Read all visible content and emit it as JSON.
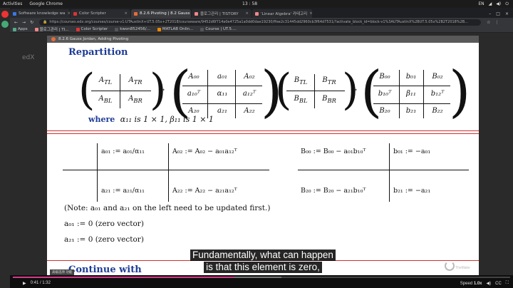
{
  "os_bar": {
    "activities": "Activities",
    "app": "Google Chrome",
    "clock": "13 : 58",
    "lang": "EN"
  },
  "tabs": [
    {
      "label": "Software knowledge wa",
      "color": "#3b78e7"
    },
    {
      "label": "Color Scripter",
      "color": "#d33"
    },
    {
      "label": "8.2.6 Pivoting | 8.2 Gauss",
      "color": "#e86a3a",
      "active": true
    },
    {
      "label": "블로그관리 | TISTORY",
      "color": "#e88"
    },
    {
      "label": "'Linear Algebra' 카테고리",
      "color": "#e88"
    }
  ],
  "address": {
    "url": "https://courses.edx.org/courses/course-v1:UTAustinX+UT.5.05x+2T2018/courseware/9452d6f714a0e4725a1a0dd0dae19230/ffee2c31445dd2960cb3f64d7531/?activate_block_id=block-v1%3AUTAustinX%2BUT.5.05x%2B2T2018%2B..."
  },
  "bookmarks": [
    {
      "label": "Apps",
      "color": "#5a8"
    },
    {
      "label": "블로그관리 | TI...",
      "color": "#e88"
    },
    {
      "label": "Color Scripter",
      "color": "#d33"
    },
    {
      "label": "kwon852456/...",
      "color": "#555"
    },
    {
      "label": "MATLAB Onlin...",
      "color": "#e80"
    },
    {
      "label": "Course | UT.5....",
      "color": "#555"
    }
  ],
  "page_bg_text": "edX",
  "video_title": "8.2.6 Gauss Jordan, Adding Pivoting",
  "slide": {
    "heading": "Repartition",
    "lhs_A": [
      [
        "A",
        "TL",
        "A",
        "TR"
      ],
      [
        "A",
        "BL",
        "A",
        "BR"
      ]
    ],
    "arrow": "→",
    "comma": ",",
    "rhs_A": [
      [
        "A₀₀",
        "a₀₁",
        "A₀₂"
      ],
      [
        "a₁₀ᵀ",
        "α₁₁",
        "a₁₂ᵀ"
      ],
      [
        "A₂₀",
        "a₂₁",
        "A₂₂"
      ]
    ],
    "lhs_B": [
      [
        "B",
        "TL",
        "B",
        "TR"
      ],
      [
        "B",
        "BL",
        "B",
        "BR"
      ]
    ],
    "rhs_B": [
      [
        "B₀₀",
        "b₀₁",
        "B₀₂"
      ],
      [
        "b₁₀ᵀ",
        "β₁₁",
        "b₁₂ᵀ"
      ],
      [
        "B₂₀",
        "b₂₁",
        "B₂₂"
      ]
    ],
    "where_kw": "where",
    "where_text": "α₁₁ is 1 × 1, β₁₁ is 1 × 1",
    "update_A": {
      "top_left": "a₀₁ := a₀₁/α₁₁",
      "top_right": "A₀₂ := A₀₂ − a₀₁a₁₂ᵀ",
      "bot_left": "a₂₁ := a₂₁/α₁₁",
      "bot_right": "A₂₂ := A₂₂ − a₂₁a₁₂ᵀ"
    },
    "update_B": {
      "top_left": "B₀₀ := B₀₀ − a₀₁b₁₀ᵀ",
      "top_right": "b₀₁ := −a₀₁",
      "bot_left": "B₂₀ := B₂₀ − a₂₁b₁₀ᵀ",
      "bot_right": "b₂₁ := −a₂₁"
    },
    "note": "(Note:  a₀₁ and a₂₁ on the left need to be updated first.)",
    "zero1": "a₀₁ := 0    (zero vector)",
    "zero2": "a₂₁ := 0    (zero vector)",
    "continue": "Continue with"
  },
  "captions": {
    "line1": "Fundamentally, what can happen",
    "line2": "is that this element is zero,"
  },
  "watermark": "TheMake",
  "badge": "高级选项 功能",
  "player": {
    "time": "0:41 / 1:32",
    "speed": "Speed",
    "speed_value": "1.0x",
    "progress": 0.445,
    "buffered": 0.54
  }
}
